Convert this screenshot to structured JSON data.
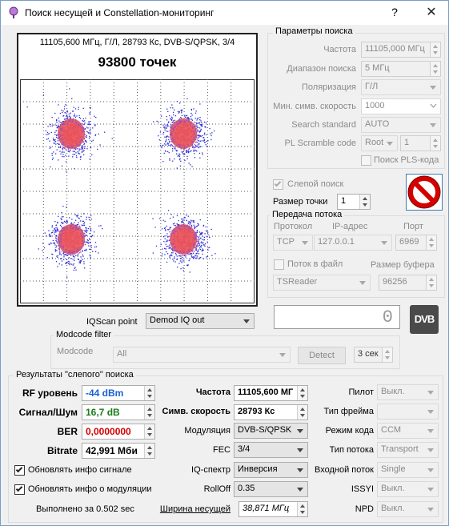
{
  "window": {
    "title": "Поиск несущей и Constellation-мониторинг",
    "help": "?",
    "close": "✕"
  },
  "constellation": {
    "header": "11105,600 МГц, Г/Л, 28793 Кс, DVB-S/QPSK, 3/4",
    "points_label": "93800 точек"
  },
  "search_params": {
    "title": "Параметры поиска",
    "frequency_label": "Частота",
    "frequency_value": "11105,000 МГц",
    "range_label": "Диапазон поиска",
    "range_value": "5 МГц",
    "polarization_label": "Поляризация",
    "polarization_value": "Г/Л",
    "min_sr_label": "Мин. симв. скорость",
    "min_sr_value": "1000",
    "standard_label": "Search standard",
    "standard_value": "AUTO",
    "pls_label": "PL Scramble code",
    "pls_mode": "Root",
    "pls_value": "1",
    "pls_search_label": "Поиск PLS-кода"
  },
  "blind": {
    "label": "Слепой поиск",
    "point_size_label": "Размер точки",
    "point_size_value": "1"
  },
  "stream": {
    "title": "Передача потока",
    "protocol_label": "Протокол",
    "ip_label": "IP-адрес",
    "port_label": "Порт",
    "protocol_value": "TCP",
    "ip_value": "127.0.0.1",
    "port_value": "6969",
    "file_label": "Поток в файл",
    "buffer_label": "Размер буфера",
    "file_target": "TSReader",
    "buffer_value": "96256"
  },
  "counter": {
    "value": "0"
  },
  "logo": {
    "text": "DVB"
  },
  "iqscan": {
    "label": "IQScan point",
    "value": "Demod IQ out"
  },
  "modcode": {
    "title": "Modcode filter",
    "label": "Modcode",
    "value": "All",
    "detect": "Detect",
    "interval": "3 сек"
  },
  "results": {
    "title": "Результаты \"слепого\" поиска",
    "rf_label": "RF уровень",
    "rf_value": "-44 dBm",
    "snr_label": "Сигнал/Шум",
    "snr_value": "16,7 dB",
    "ber_label": "BER",
    "ber_value": "0,0000000",
    "bitrate_label": "Bitrate",
    "bitrate_value": "42,991 Мби",
    "update_signal": "Обновлять инфо сигнале",
    "update_modulation": "Обновлять инфо о модуляции",
    "done": "Выполнено за 0.502 sec",
    "freq_label": "Частота",
    "freq_value": "11105,600 МГ",
    "sr_label": "Симв. скорость",
    "sr_value": "28793 Кс",
    "mod_label": "Модуляция",
    "mod_value": "DVB-S/QPSK",
    "fec_label": "FEC",
    "fec_value": "3/4",
    "iq_label": "IQ-спектр",
    "iq_value": "Инверсия",
    "rolloff_label": "RollOff",
    "rolloff_value": "0.35",
    "bw_label": "Ширина несущей",
    "bw_value": "38,871 МГц",
    "pilot_label": "Пилот",
    "pilot_value": "Выкл.",
    "frame_label": "Тип фрейма",
    "frame_value": "",
    "code_label": "Режим кода",
    "code_value": "CCM",
    "stream_type_label": "Тип потока",
    "stream_type_value": "Transport",
    "input_label": "Входной поток",
    "input_value": "Single",
    "issyi_label": "ISSYI",
    "issyi_value": "Выкл.",
    "npd_label": "NPD",
    "npd_value": "Выкл."
  },
  "colors": {
    "rf": "#1a5fd6",
    "snr": "#1b7a1b",
    "ber": "#d40000",
    "cloud_center": "#e8505a",
    "cloud_edge": "#2a2ad8"
  }
}
